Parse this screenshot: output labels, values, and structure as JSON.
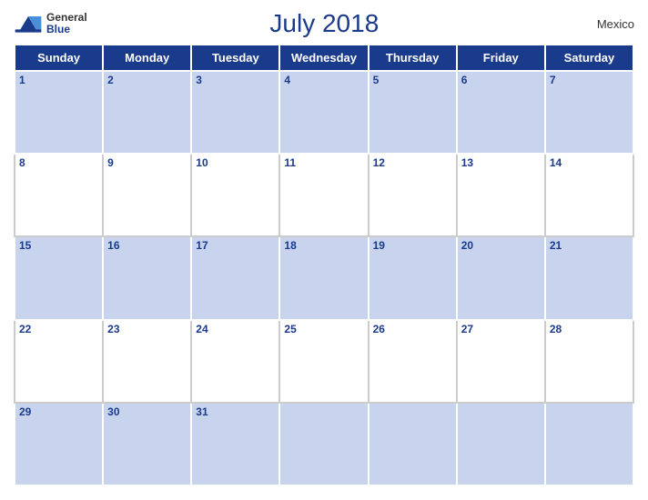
{
  "header": {
    "logo_general": "General",
    "logo_blue": "Blue",
    "title": "July 2018",
    "country": "Mexico"
  },
  "days_of_week": [
    "Sunday",
    "Monday",
    "Tuesday",
    "Wednesday",
    "Thursday",
    "Friday",
    "Saturday"
  ],
  "weeks": [
    [
      {
        "day": 1,
        "has_date": true
      },
      {
        "day": 2,
        "has_date": true
      },
      {
        "day": 3,
        "has_date": true
      },
      {
        "day": 4,
        "has_date": true
      },
      {
        "day": 5,
        "has_date": true
      },
      {
        "day": 6,
        "has_date": true
      },
      {
        "day": 7,
        "has_date": true
      }
    ],
    [
      {
        "day": 8,
        "has_date": true
      },
      {
        "day": 9,
        "has_date": true
      },
      {
        "day": 10,
        "has_date": true
      },
      {
        "day": 11,
        "has_date": true
      },
      {
        "day": 12,
        "has_date": true
      },
      {
        "day": 13,
        "has_date": true
      },
      {
        "day": 14,
        "has_date": true
      }
    ],
    [
      {
        "day": 15,
        "has_date": true
      },
      {
        "day": 16,
        "has_date": true
      },
      {
        "day": 17,
        "has_date": true
      },
      {
        "day": 18,
        "has_date": true
      },
      {
        "day": 19,
        "has_date": true
      },
      {
        "day": 20,
        "has_date": true
      },
      {
        "day": 21,
        "has_date": true
      }
    ],
    [
      {
        "day": 22,
        "has_date": true
      },
      {
        "day": 23,
        "has_date": true
      },
      {
        "day": 24,
        "has_date": true
      },
      {
        "day": 25,
        "has_date": true
      },
      {
        "day": 26,
        "has_date": true
      },
      {
        "day": 27,
        "has_date": true
      },
      {
        "day": 28,
        "has_date": true
      }
    ],
    [
      {
        "day": 29,
        "has_date": true
      },
      {
        "day": 30,
        "has_date": true
      },
      {
        "day": 31,
        "has_date": true
      },
      {
        "day": null,
        "has_date": false
      },
      {
        "day": null,
        "has_date": false
      },
      {
        "day": null,
        "has_date": false
      },
      {
        "day": null,
        "has_date": false
      }
    ]
  ],
  "colors": {
    "header_bg": "#1a3a8c",
    "row_blue": "#c8d4ee",
    "row_white": "#ffffff",
    "day_number": "#1a3a8c",
    "border": "#ffffff"
  }
}
